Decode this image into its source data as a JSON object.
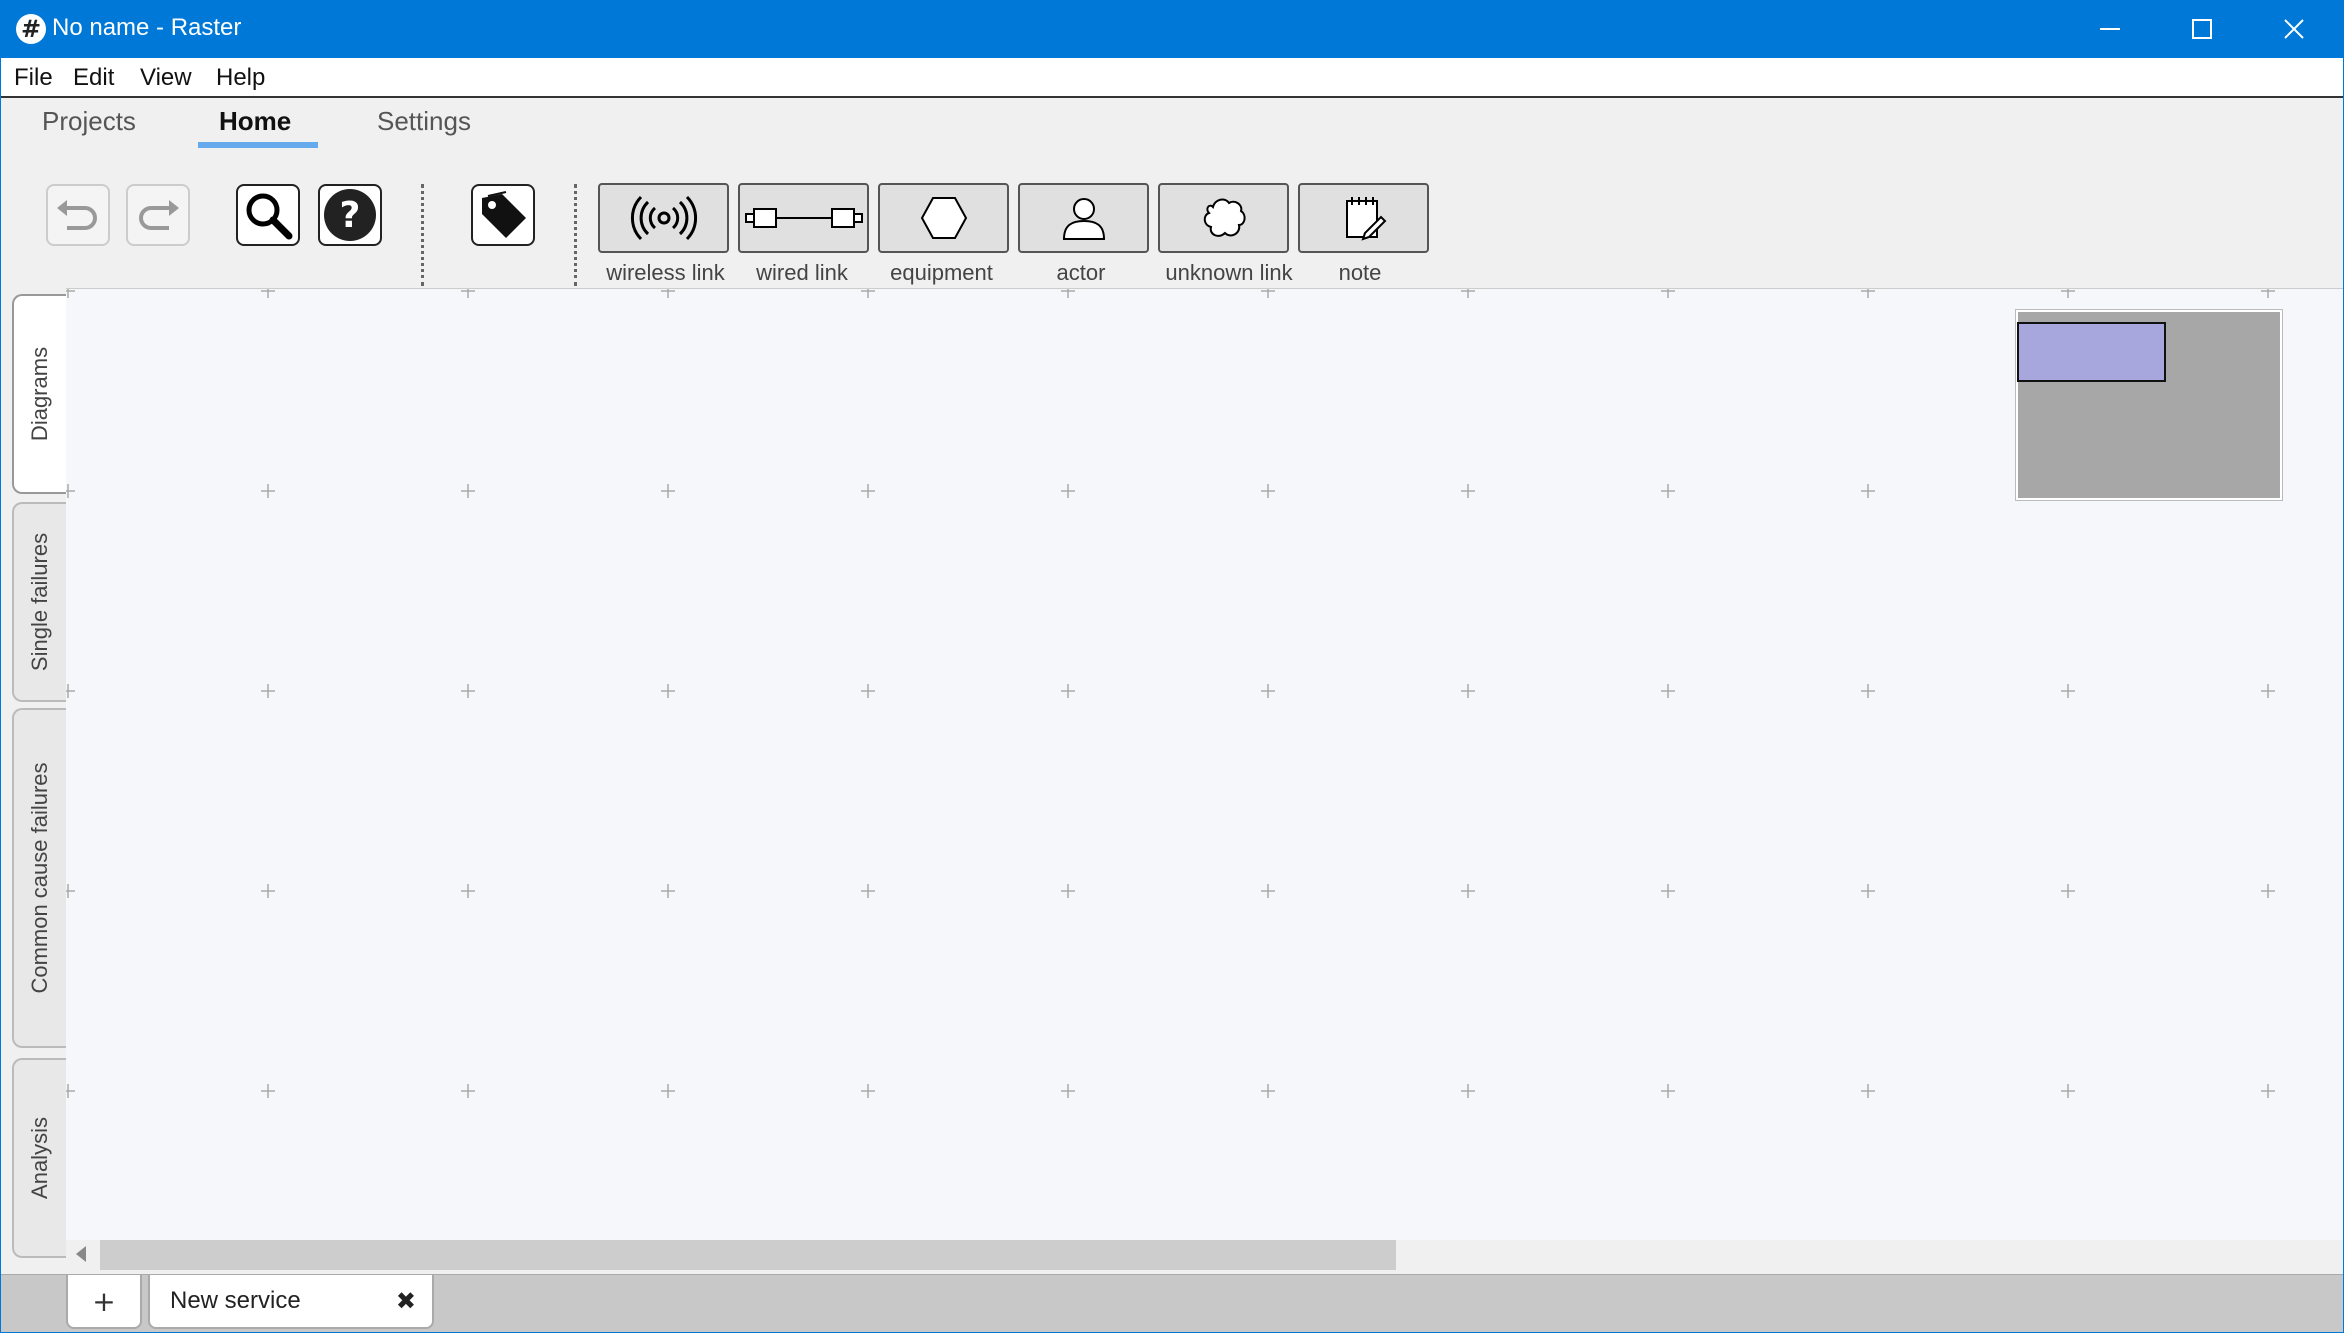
{
  "window": {
    "title": "No name - Raster",
    "app_icon_glyph": "#"
  },
  "menu": [
    "File",
    "Edit",
    "View",
    "Help"
  ],
  "ribbon": {
    "tabs": [
      "Projects",
      "Home",
      "Settings"
    ],
    "active_tab": "Home",
    "tools": [
      {
        "icon": "undo-icon",
        "enabled": false
      },
      {
        "icon": "redo-icon",
        "enabled": false
      },
      {
        "icon": "search-icon",
        "enabled": true
      },
      {
        "icon": "help-icon",
        "enabled": true
      },
      {
        "icon": "tag-icon",
        "enabled": true
      }
    ],
    "node_buttons": [
      {
        "label": "wireless link",
        "icon": "wireless-icon"
      },
      {
        "label": "wired link",
        "icon": "wired-link-icon"
      },
      {
        "label": "equipment",
        "icon": "hexagon-icon"
      },
      {
        "label": "actor",
        "icon": "person-icon"
      },
      {
        "label": "unknown link",
        "icon": "cloud-icon"
      },
      {
        "label": "note",
        "icon": "note-edit-icon"
      }
    ]
  },
  "side_tabs": [
    "Diagrams",
    "Single failures",
    "Common cause failures",
    "Analysis"
  ],
  "active_side_tab": "Diagrams",
  "bottom_tabs": {
    "add_label": "+",
    "tabs": [
      {
        "label": "New service",
        "close": "✖"
      }
    ]
  },
  "colors": {
    "titlebar": "#0078d7",
    "canvas": "#f6f7fb",
    "minimap": "#a7a7a7",
    "minimap_view": "#a7a7dd",
    "tab_underline": "#66aaee"
  }
}
